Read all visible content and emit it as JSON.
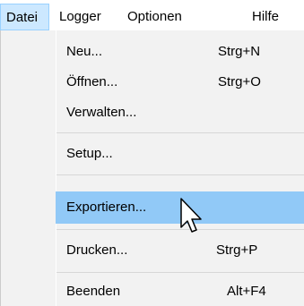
{
  "menubar": {
    "items": [
      {
        "label": "Datei"
      },
      {
        "label": "Logger"
      },
      {
        "label": "Optionen"
      },
      {
        "label": "Hilfe"
      }
    ]
  },
  "menu": {
    "items": [
      {
        "label": "Neu...",
        "shortcut": "Strg+N"
      },
      {
        "label": "Öffnen...",
        "shortcut": "Strg+O"
      },
      {
        "label": "Verwalten...",
        "shortcut": ""
      },
      {
        "label": "Setup...",
        "shortcut": ""
      },
      {
        "label": "Exportieren...",
        "shortcut": ""
      },
      {
        "label": "Drucken...",
        "shortcut": "Strg+P"
      },
      {
        "label": "Beenden",
        "shortcut": "Alt+F4"
      }
    ]
  },
  "colors": {
    "menubar_active_bg": "#cce8ff",
    "menu_bg": "#f2f2f2",
    "highlight_bg": "#91c9f7"
  }
}
